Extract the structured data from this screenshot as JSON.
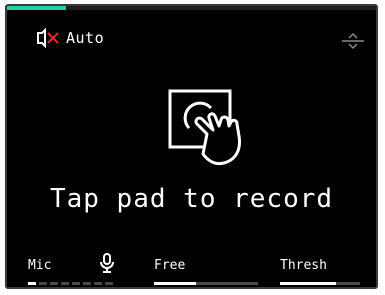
{
  "status": {
    "mode_label": "Auto",
    "recording_progress": 0.16
  },
  "icons": {
    "muted": "speaker-muted-icon",
    "range": "range-arrows-icon",
    "tap": "tap-pad-icon",
    "mic": "microphone-icon"
  },
  "main": {
    "prompt": "Tap pad to record"
  },
  "bottom": {
    "mic_label": "Mic",
    "mic_meter": {
      "segments_total": 8,
      "segments_on": 1
    },
    "free_label": "Free",
    "free_level": 0.4,
    "thresh_label": "Thresh",
    "thresh_level": 0.7
  },
  "colors": {
    "accent": "#1fd3a4",
    "mute_x": "#e0282b",
    "background": "#000000",
    "foreground": "#ffffff",
    "inactive": "#4a4a4a"
  }
}
